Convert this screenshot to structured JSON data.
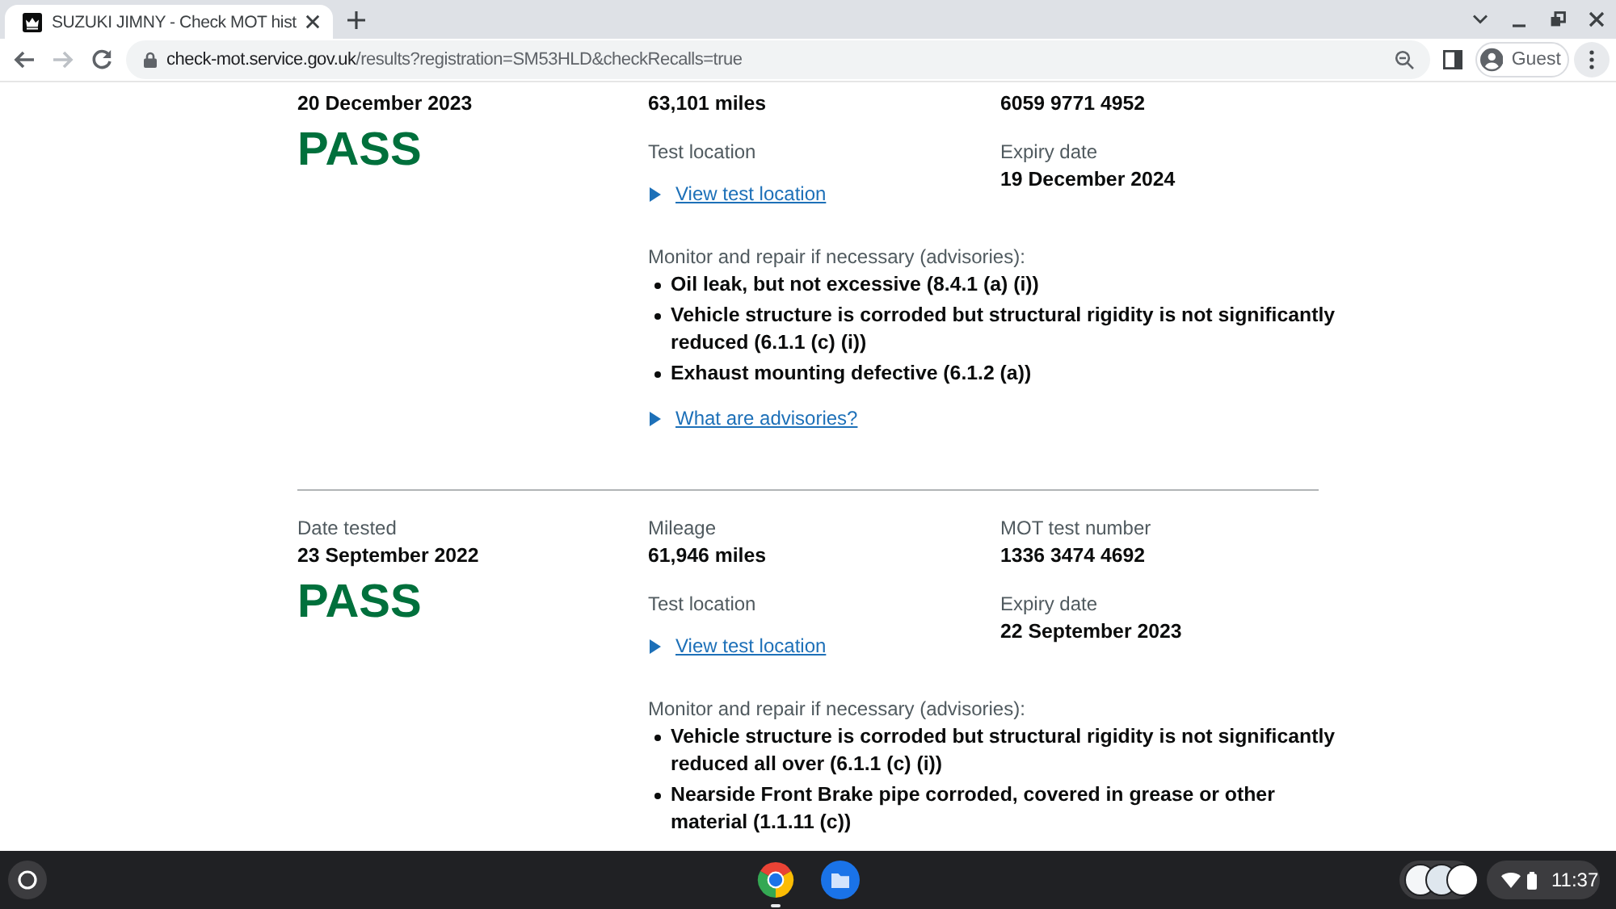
{
  "browser": {
    "tabs": [
      {
        "title": "SUZUKI JIMNY - Check MOT hist",
        "selected": true
      }
    ],
    "nav_buttons": [
      {
        "kind": "back",
        "disabled": false
      },
      {
        "kind": "forward",
        "disabled": true
      },
      {
        "kind": "reload",
        "disabled": false
      }
    ],
    "address_bar": {
      "domain": "check-mot.service.gov.uk",
      "path": "/results?registration=SM53HLD&checkRecalls=true"
    },
    "profile": {
      "label": "Guest"
    }
  },
  "mot_tests": [
    {
      "date_tested": {
        "value": "20 December 2023"
      },
      "result": {
        "text": "PASS",
        "kind": "pass"
      },
      "mileage": {
        "value": "63,101 miles"
      },
      "test_number": {
        "value": "6059 9771 4952"
      },
      "test_location": {
        "label": "Test location",
        "link": "View test location"
      },
      "expiry": {
        "label": "Expiry date",
        "value": "19 December 2024"
      },
      "advisories": {
        "heading": "Monitor and repair if necessary (advisories):",
        "items": [
          "Oil leak, but not excessive (8.4.1 (a) (i))",
          "Vehicle structure is corroded but structural rigidity is not significantly reduced (6.1.1 (c) (i))",
          "Exhaust mounting defective (6.1.2 (a))"
        ],
        "link": "What are advisories?"
      }
    },
    {
      "date_tested": {
        "label": "Date tested",
        "value": "23 September 2022"
      },
      "result": {
        "text": "PASS",
        "kind": "pass"
      },
      "mileage": {
        "label": "Mileage",
        "value": "61,946 miles"
      },
      "test_number": {
        "label": "MOT test number",
        "value": "1336 3474 4692"
      },
      "test_location": {
        "label": "Test location",
        "link": "View test location"
      },
      "expiry": {
        "label": "Expiry date",
        "value": "22 September 2023"
      },
      "advisories": {
        "heading": "Monitor and repair if necessary (advisories):",
        "items": [
          "Vehicle structure is corroded but structural rigidity is not significantly reduced all over (6.1.1 (c) (i))",
          "Nearside Front Brake pipe corroded, covered in grease or other material (1.1.11 (c))"
        ]
      }
    }
  ],
  "taskbar": {
    "apps": [
      {
        "kind": "browser",
        "running": true
      },
      {
        "kind": "files",
        "running": false
      }
    ],
    "clock": "11:37"
  }
}
